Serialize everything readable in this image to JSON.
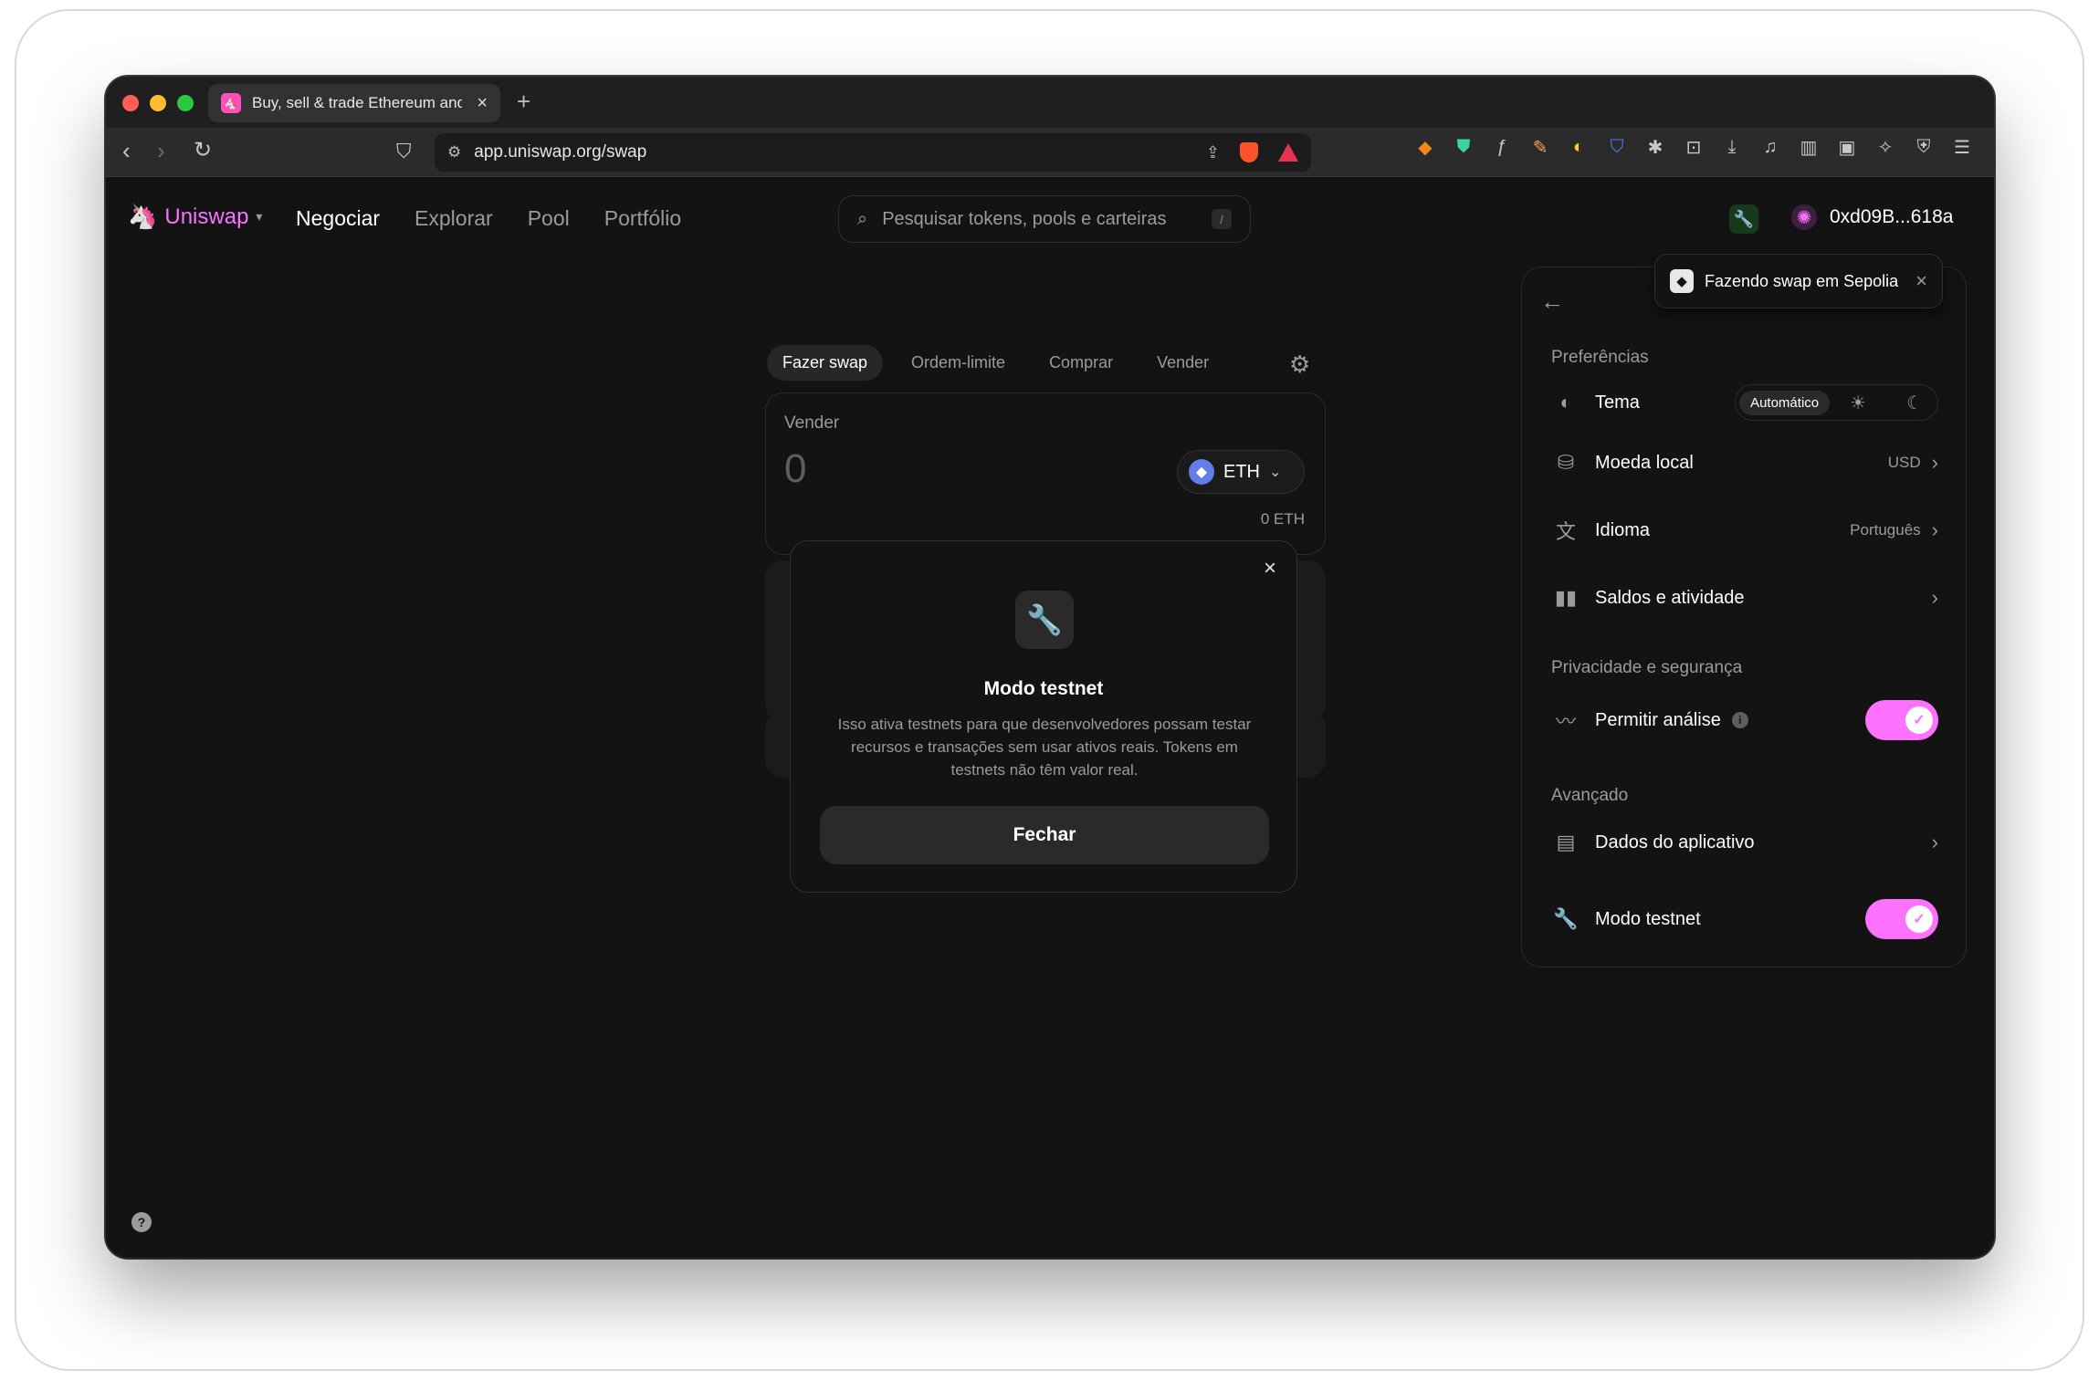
{
  "browser": {
    "tab_title": "Buy, sell & trade Ethereum and",
    "tab_close": "×",
    "new_tab": "+",
    "url": "app.uniswap.org/swap"
  },
  "header": {
    "logo": "Uniswap",
    "logo_caret": "▾",
    "nav": [
      "Negociar",
      "Explorar",
      "Pool",
      "Portfólio"
    ],
    "search_placeholder": "Pesquisar tokens, pools e carteiras",
    "search_shortcut": "/",
    "account": "0xd09B...618a"
  },
  "swap": {
    "tabs": [
      "Fazer swap",
      "Ordem-limite",
      "Comprar",
      "Vender"
    ],
    "sell_label": "Vender",
    "sell_amount": "0",
    "token": "ETH",
    "balance": "0 ETH"
  },
  "modal": {
    "title": "Modo testnet",
    "description": "Isso ativa testnets para que desenvolvedores possam testar recursos e transações sem usar ativos reais. Tokens em testnets não têm valor real.",
    "button": "Fechar",
    "close": "×"
  },
  "toast": {
    "text": "Fazendo swap em Sepolia",
    "close": "×"
  },
  "settings": {
    "preferences_title": "Preferências",
    "theme_label": "Tema",
    "theme_auto": "Automático",
    "currency_label": "Moeda local",
    "currency_value": "USD",
    "language_label": "Idioma",
    "language_value": "Português",
    "balances_label": "Saldos e atividade",
    "privacy_title": "Privacidade e segurança",
    "analytics_label": "Permitir análise",
    "analytics_enabled": true,
    "advanced_title": "Avançado",
    "app_data_label": "Dados do aplicativo",
    "testnet_label": "Modo testnet",
    "testnet_enabled": true
  },
  "colors": {
    "accent": "#fc72ff",
    "background": "#131313",
    "text_secondary": "#9b9b9b"
  }
}
